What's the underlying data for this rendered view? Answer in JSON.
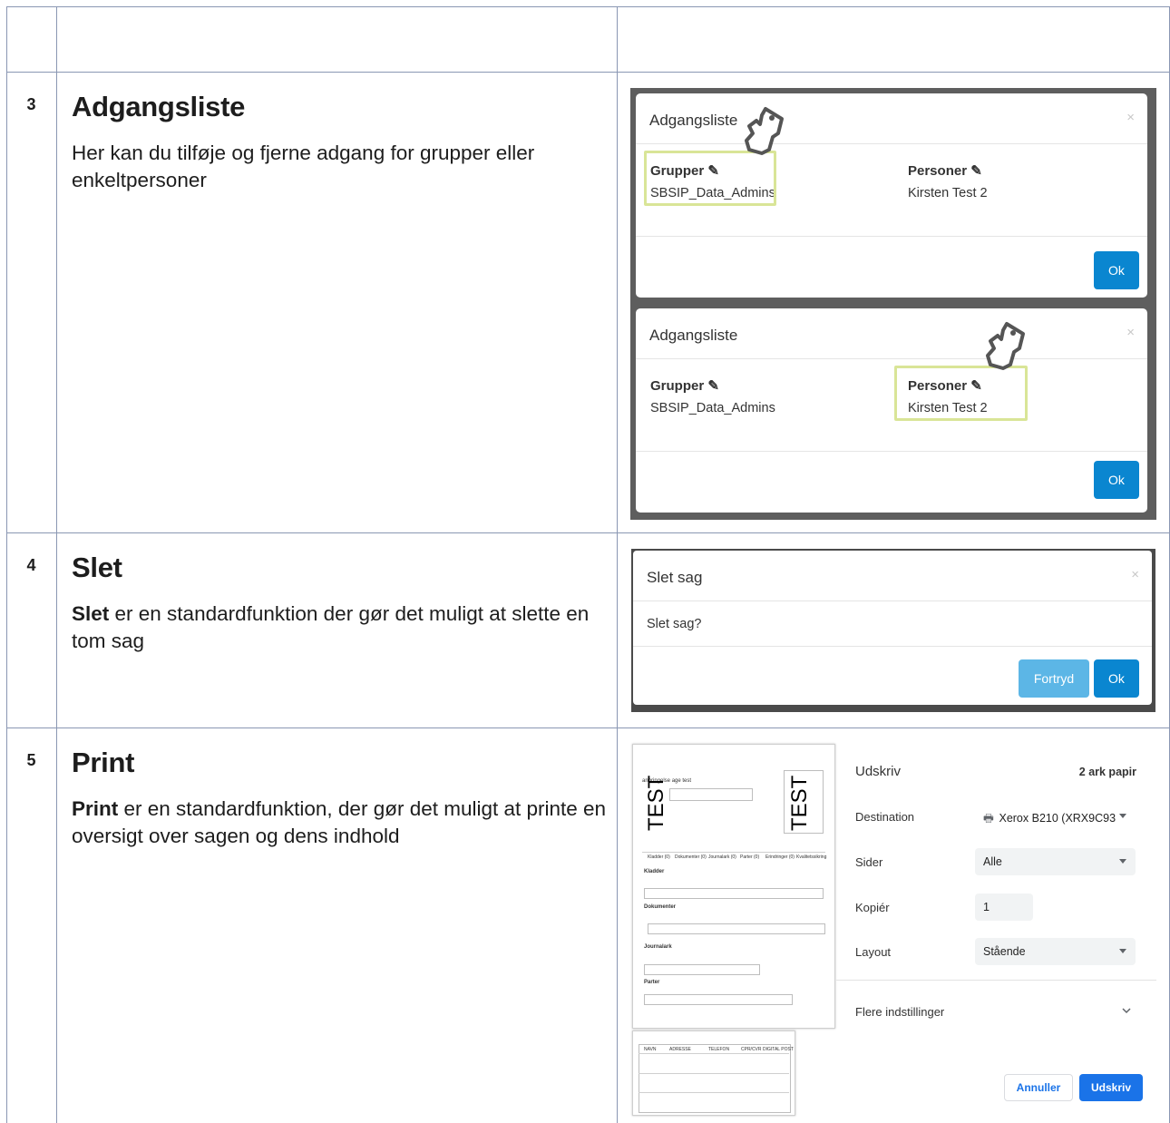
{
  "rows": [
    {
      "number": "3",
      "title": "Adgangsliste",
      "text": "Her kan du tilføje og fjerne adgang for grupper eller enkeltpersoner"
    },
    {
      "number": "4",
      "title": "Slet",
      "bold": "Slet",
      "text": " er en standardfunktion der gør det muligt at slette en tom sag"
    },
    {
      "number": "5",
      "title": "Print",
      "bold": "Print",
      "text": " er en standardfunktion, der gør det muligt at printe en oversigt over sagen og dens indhold"
    }
  ],
  "access_modal": {
    "title": "Adgangsliste",
    "close": "×",
    "groups_label": "Grupper",
    "groups_value": "SBSIP_Data_Admins",
    "persons_label": "Personer",
    "persons_value": "Kirsten Test 2",
    "ok": "Ok"
  },
  "delete_modal": {
    "title": "Slet sag",
    "close": "×",
    "body": "Slet sag?",
    "cancel": "Fortryd",
    "ok": "Ok"
  },
  "print_dialog": {
    "title": "Udskriv",
    "sheets": "2 ark papir",
    "destination_label": "Destination",
    "destination_value": "Xerox B210 (XRX9C93",
    "pages_label": "Sider",
    "pages_value": "Alle",
    "copies_label": "Kopiér",
    "copies_value": "1",
    "layout_label": "Layout",
    "layout_value": "Stående",
    "more_settings": "Flere indstillinger",
    "cancel": "Annuller",
    "print": "Udskriv"
  },
  "preview": {
    "watermark": "TEST",
    "case_title": "anbringelse age test",
    "sections": [
      "Kladder",
      "Dokumenter",
      "Journalark",
      "Parter"
    ],
    "tabs": [
      "Kladder (0)",
      "Dokumenter (0)",
      "Journalark (0)",
      "Parter (0)",
      "Erindringer (0)",
      "Kvalitetssikring"
    ],
    "table_heads": [
      "NAVN",
      "ADRESSE",
      "TELEFON",
      "CPR/CVR",
      "DIGITAL POST"
    ]
  },
  "colors": {
    "highlight": "#d9e597",
    "ok_blue": "#0a86d0",
    "cancel_blue": "#5cb6e6",
    "print_blue": "#1a73e8",
    "grid": "#8a97b3"
  }
}
